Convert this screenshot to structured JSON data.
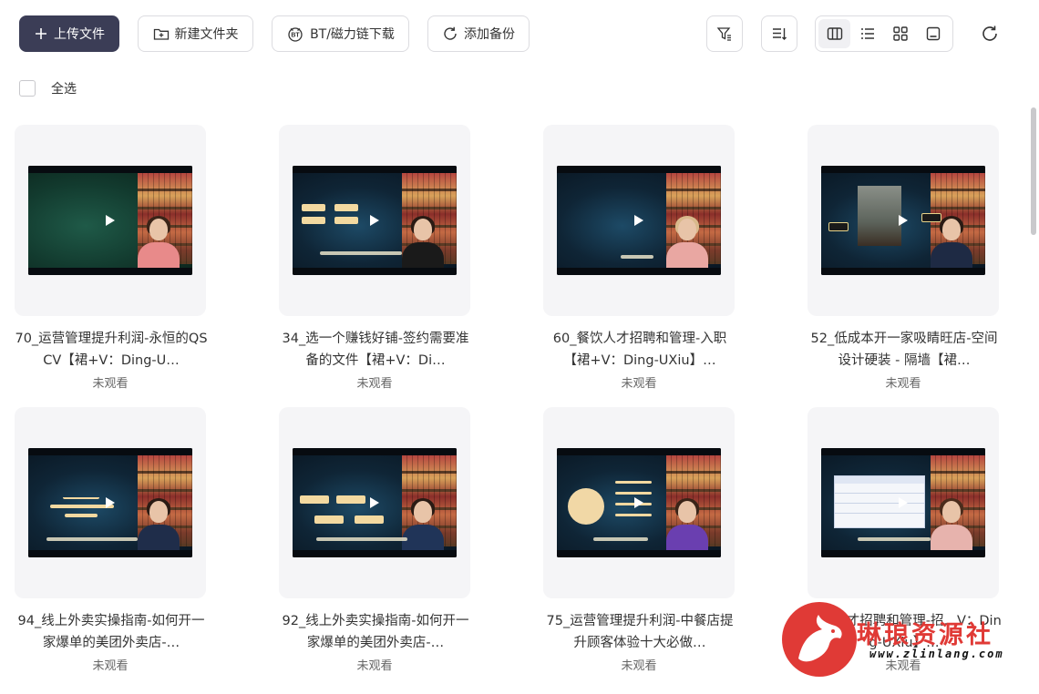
{
  "toolbar": {
    "upload_label": "上传文件",
    "new_folder_label": "新建文件夹",
    "bt_label": "BT/磁力链下载",
    "backup_label": "添加备份"
  },
  "select_all": {
    "label": "全选"
  },
  "files": [
    {
      "title": "70_运营管理提升利润-永恒的QSCV【裙+V：Ding-U…",
      "status": "未观看"
    },
    {
      "title": "34_选一个赚钱好铺-签约需要准备的文件【裙+V：Di…",
      "status": "未观看"
    },
    {
      "title": "60_餐饮人才招聘和管理-入职【裙+V：Ding-UXiu】…",
      "status": "未观看"
    },
    {
      "title": "52_低成本开一家吸睛旺店-空间设计硬装 - 隔墙【裙…",
      "status": "未观看"
    },
    {
      "title": "94_线上外卖实操指南-如何开一家爆单的美团外卖店-…",
      "status": "未观看"
    },
    {
      "title": "92_线上外卖实操指南-如何开一家爆单的美团外卖店-…",
      "status": "未观看"
    },
    {
      "title": "75_运营管理提升利润-中餐店提升顾客体验十大必做…",
      "status": "未观看"
    },
    {
      "title": "餐饮人才招聘和管理-招…V：Ding-UXiu】…",
      "status": "未观看"
    }
  ],
  "watermark": {
    "brand": "琳琅资源社",
    "url": "www.zlinlang.com"
  }
}
